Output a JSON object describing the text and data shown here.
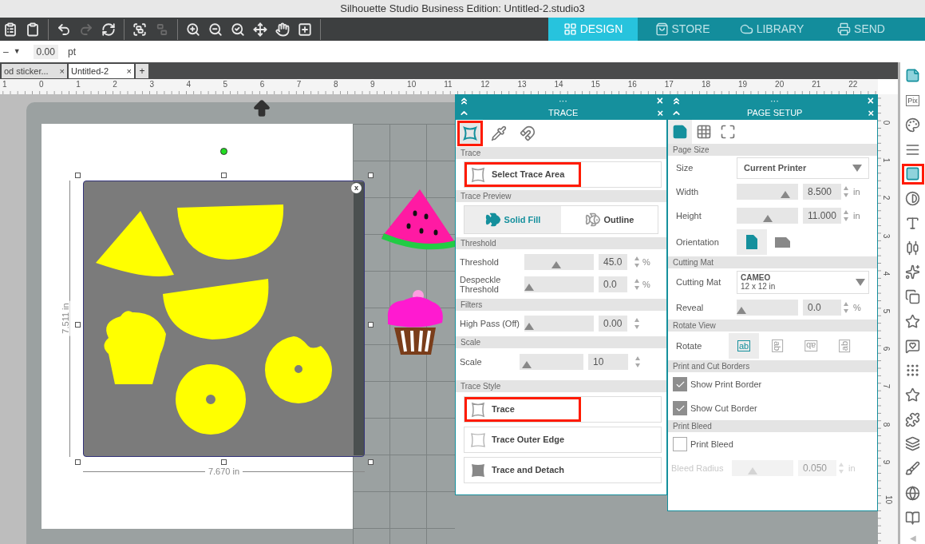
{
  "window": {
    "title": "Silhouette Studio Business Edition: Untitled-2.studio3"
  },
  "toolbar": {
    "tools": [
      {
        "disabled": false
      },
      {
        "disabled": false
      },
      {
        "disabled": false
      },
      {
        "disabled": true
      },
      {
        "disabled": false
      },
      {
        "disabled": false
      },
      {
        "disabled": true
      },
      {
        "disabled": false
      },
      {
        "disabled": false
      },
      {
        "disabled": false
      },
      {
        "disabled": false
      },
      {
        "disabled": false
      },
      {
        "disabled": false
      }
    ]
  },
  "nav_tabs": [
    {
      "label": "DESIGN",
      "selected": true
    },
    {
      "label": "STORE",
      "selected": false
    },
    {
      "label": "LIBRARY",
      "selected": false
    },
    {
      "label": "SEND",
      "selected": false
    }
  ],
  "options_bar": {
    "dash": "–",
    "caret": "▼",
    "value": "0.00",
    "unit": "pt"
  },
  "document_tabs": [
    {
      "label": "od sticker...",
      "close": "×",
      "selected": false
    },
    {
      "label": "Untitled-2",
      "close": "×",
      "selected": true
    }
  ],
  "new_tab": "+",
  "ruler": {
    "horizontal": [
      "1",
      "0",
      "1",
      "2",
      "3",
      "4",
      "5",
      "6",
      "7",
      "8",
      "9",
      "10",
      "11",
      "12",
      "13",
      "14",
      "15",
      "16",
      "17",
      "18",
      "19",
      "20",
      "21",
      "22"
    ],
    "vertical": [
      "0",
      "1",
      "2",
      "3",
      "4",
      "5",
      "6",
      "7",
      "8",
      "9",
      "10"
    ]
  },
  "canvas": {
    "width_label": "7.670 in",
    "height_label": "7.511 in",
    "close": "x"
  },
  "trace_panel": {
    "dots": "···",
    "close": "×",
    "title": "TRACE",
    "title_close": "×",
    "tools": [
      {
        "selected": true,
        "highlighted": true
      },
      {
        "selected": false,
        "highlighted": false
      },
      {
        "selected": false,
        "highlighted": false
      }
    ],
    "trace_header": "Trace",
    "select_button": {
      "label": "Select Trace Area",
      "highlighted": true
    },
    "preview_header": "Trace Preview",
    "preview_options": [
      {
        "label": "Solid Fill",
        "selected": true
      },
      {
        "label": "Outline",
        "selected": false
      }
    ],
    "threshold_header": "Threshold",
    "threshold_rows": [
      {
        "label": "Threshold",
        "level": 0.45,
        "value": "45.0",
        "unit": "%"
      },
      {
        "label": "Despeckle Threshold",
        "level": 0.0,
        "value": "0.0",
        "unit": "%"
      }
    ],
    "filters_header": "Filters",
    "filter_row": {
      "label": "High Pass (Off)",
      "level": 0.0,
      "value": "0.00"
    },
    "scale_header": "Scale",
    "scale_row": {
      "label": "Scale",
      "level": 0.05,
      "value": "10"
    },
    "style_header": "Trace Style",
    "style_buttons": [
      {
        "label": "Trace",
        "highlighted": true
      },
      {
        "label": "Trace Outer Edge",
        "highlighted": false
      },
      {
        "label": "Trace and Detach",
        "highlighted": false
      }
    ]
  },
  "page_setup_panel": {
    "dots": "···",
    "close": "×",
    "title": "PAGE SETUP",
    "title_close": "×",
    "tabs": [
      {
        "selected": true
      },
      {
        "selected": false
      },
      {
        "selected": false
      }
    ],
    "page_size_header": "Page Size",
    "size_label": "Size",
    "size_value": "Current Printer",
    "dimension_rows": [
      {
        "label": "Width",
        "level": 0.85,
        "value": "8.500",
        "unit": "in"
      },
      {
        "label": "Height",
        "level": 0.5,
        "value": "11.000",
        "unit": "in"
      }
    ],
    "orientation_label": "Orientation",
    "orientations": [
      {
        "selected": true
      },
      {
        "selected": false
      }
    ],
    "cutting_mat_header": "Cutting Mat",
    "cutting_mat_label": "Cutting Mat",
    "cutting_mat_value": "CAMEO",
    "cutting_mat_size": "12 x 12 in",
    "reveal_row": {
      "label": "Reveal",
      "level": 0.0,
      "value": "0.0",
      "unit": "%"
    },
    "rotate_header": "Rotate View",
    "rotate_label": "Rotate",
    "rotate_options": [
      {
        "label": "ab",
        "selected": true
      },
      {
        "label": "ab",
        "selected": false
      },
      {
        "label": "ab",
        "selected": false
      },
      {
        "label": "ab",
        "selected": false
      }
    ],
    "borders_header": "Print and Cut Borders",
    "borders": [
      {
        "label": "Show Print Border",
        "checked": true
      },
      {
        "label": "Show Cut Border",
        "checked": true
      }
    ],
    "bleed_header": "Print Bleed",
    "bleed": {
      "label": "Print Bleed",
      "checked": false
    },
    "bleed_radius": {
      "label": "Bleed Radius",
      "disabled": true,
      "level": 0.3,
      "value": "0.050",
      "unit": "in"
    }
  },
  "sidebar": {
    "items": [
      {
        "selected": true,
        "highlighted": false
      },
      {
        "selected": false,
        "highlighted": false,
        "label": "Pix"
      },
      {
        "selected": false,
        "highlighted": false
      },
      {
        "selected": false,
        "highlighted": false
      },
      {
        "selected": true,
        "highlighted": true
      },
      {
        "selected": false,
        "highlighted": false
      },
      {
        "selected": false,
        "highlighted": false
      },
      {
        "selected": false,
        "highlighted": false
      },
      {
        "selected": false,
        "highlighted": false
      },
      {
        "selected": false,
        "highlighted": false
      },
      {
        "selected": false,
        "highlighted": false
      },
      {
        "selected": false,
        "highlighted": false
      },
      {
        "selected": false,
        "highlighted": false
      },
      {
        "selected": false,
        "highlighted": false
      },
      {
        "selected": false,
        "highlighted": false
      },
      {
        "selected": false,
        "highlighted": false
      },
      {
        "selected": false,
        "highlighted": false
      },
      {
        "selected": false,
        "highlighted": false
      },
      {
        "selected": false,
        "highlighted": false
      }
    ],
    "collapse": "◀"
  }
}
